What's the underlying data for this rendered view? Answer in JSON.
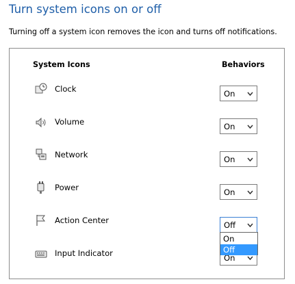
{
  "header": {
    "title": "Turn system icons on or off",
    "description": "Turning off a system icon removes the icon and turns off notifications."
  },
  "table": {
    "col_icons": "System Icons",
    "col_behaviors": "Behaviors"
  },
  "rows": [
    {
      "label": "Clock",
      "value": "On",
      "icon": "clock-icon"
    },
    {
      "label": "Volume",
      "value": "On",
      "icon": "speaker-icon"
    },
    {
      "label": "Network",
      "value": "On",
      "icon": "network-icon"
    },
    {
      "label": "Power",
      "value": "On",
      "icon": "power-plug-icon"
    },
    {
      "label": "Action Center",
      "value": "Off",
      "icon": "flag-icon"
    },
    {
      "label": "Input Indicator",
      "value": "On",
      "icon": "keyboard-icon"
    }
  ],
  "dropdown": {
    "options": [
      "On",
      "Off"
    ],
    "selected": "Off",
    "highlight_color": "#3399ff"
  }
}
